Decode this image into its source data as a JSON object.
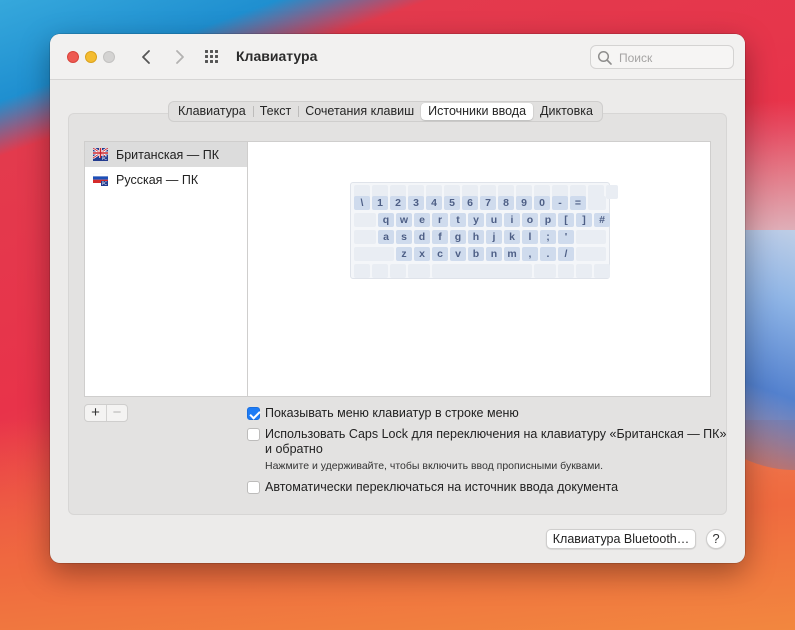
{
  "window": {
    "title": "Клавиатура",
    "search_placeholder": "Поиск"
  },
  "tabs": [
    {
      "label": "Клавиатура",
      "active": false
    },
    {
      "label": "Текст",
      "active": false
    },
    {
      "label": "Сочетания клавиш",
      "active": false
    },
    {
      "label": "Источники ввода",
      "active": true
    },
    {
      "label": "Диктовка",
      "active": false
    }
  ],
  "input_sources": [
    {
      "label": "Британская — ПК",
      "flag": "uk-flag-icon",
      "selected": true
    },
    {
      "label": "Русская — ПК",
      "flag": "ru-flag-icon",
      "selected": false
    }
  ],
  "list_controls": {
    "add": "+",
    "remove": "−"
  },
  "keyboard_preview": {
    "rows": [
      [
        "\\",
        "1",
        "2",
        "3",
        "4",
        "5",
        "6",
        "7",
        "8",
        "9",
        "0",
        "-",
        "="
      ],
      [
        "q",
        "w",
        "e",
        "r",
        "t",
        "y",
        "u",
        "i",
        "o",
        "p",
        "[",
        "]",
        "#"
      ],
      [
        "a",
        "s",
        "d",
        "f",
        "g",
        "h",
        "j",
        "k",
        "l",
        ";",
        "'"
      ],
      [
        "z",
        "x",
        "c",
        "v",
        "b",
        "n",
        "m",
        ",",
        ".",
        "/"
      ]
    ]
  },
  "options": {
    "show_menu": {
      "label": "Показывать меню клавиатур в строке меню",
      "checked": true
    },
    "caps_lock": {
      "line1": "Использовать Caps Lock для переключения на клавиатуру «Британская — ПК»",
      "line2": "и обратно",
      "checked": false
    },
    "caps_hint": "Нажмите и удерживайте, чтобы включить ввод прописными буквами.",
    "auto_switch": {
      "label": "Автоматически переключаться на источник ввода документа",
      "checked": false
    }
  },
  "footer": {
    "bluetooth_button": "Клавиатура Bluetooth…",
    "help_button": "?"
  },
  "colors": {
    "accent": "#1e7cf5",
    "close": "#ee5a52",
    "minimize": "#f4bc31",
    "zoom_disabled": "#d4d3d2"
  }
}
